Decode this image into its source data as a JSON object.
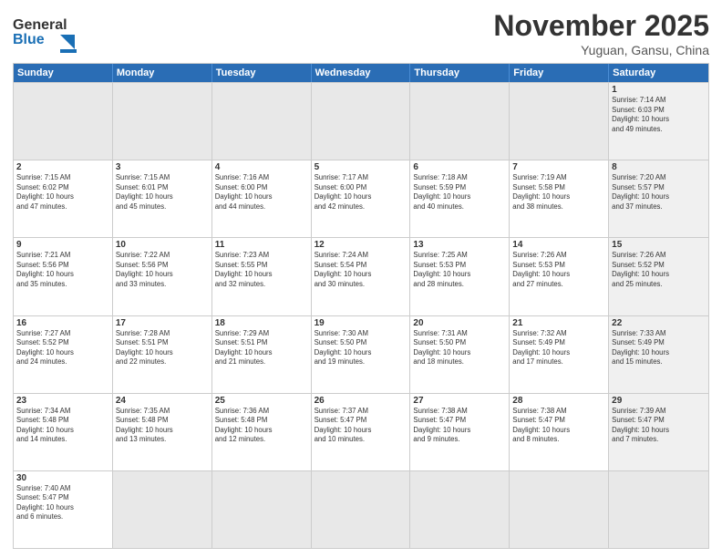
{
  "header": {
    "logo_general": "General",
    "logo_blue": "Blue",
    "month_title": "November 2025",
    "location": "Yuguan, Gansu, China"
  },
  "weekdays": [
    "Sunday",
    "Monday",
    "Tuesday",
    "Wednesday",
    "Thursday",
    "Friday",
    "Saturday"
  ],
  "rows": [
    [
      {
        "day": "",
        "info": "",
        "empty": true
      },
      {
        "day": "",
        "info": "",
        "empty": true
      },
      {
        "day": "",
        "info": "",
        "empty": true
      },
      {
        "day": "",
        "info": "",
        "empty": true
      },
      {
        "day": "",
        "info": "",
        "empty": true
      },
      {
        "day": "",
        "info": "",
        "empty": true
      },
      {
        "day": "1",
        "info": "Sunrise: 7:14 AM\nSunset: 6:03 PM\nDaylight: 10 hours\nand 49 minutes.",
        "empty": false
      }
    ],
    [
      {
        "day": "2",
        "info": "Sunrise: 7:15 AM\nSunset: 6:02 PM\nDaylight: 10 hours\nand 47 minutes.",
        "empty": false
      },
      {
        "day": "3",
        "info": "Sunrise: 7:15 AM\nSunset: 6:01 PM\nDaylight: 10 hours\nand 45 minutes.",
        "empty": false
      },
      {
        "day": "4",
        "info": "Sunrise: 7:16 AM\nSunset: 6:00 PM\nDaylight: 10 hours\nand 44 minutes.",
        "empty": false
      },
      {
        "day": "5",
        "info": "Sunrise: 7:17 AM\nSunset: 6:00 PM\nDaylight: 10 hours\nand 42 minutes.",
        "empty": false
      },
      {
        "day": "6",
        "info": "Sunrise: 7:18 AM\nSunset: 5:59 PM\nDaylight: 10 hours\nand 40 minutes.",
        "empty": false
      },
      {
        "day": "7",
        "info": "Sunrise: 7:19 AM\nSunset: 5:58 PM\nDaylight: 10 hours\nand 38 minutes.",
        "empty": false
      },
      {
        "day": "8",
        "info": "Sunrise: 7:20 AM\nSunset: 5:57 PM\nDaylight: 10 hours\nand 37 minutes.",
        "empty": false
      }
    ],
    [
      {
        "day": "9",
        "info": "Sunrise: 7:21 AM\nSunset: 5:56 PM\nDaylight: 10 hours\nand 35 minutes.",
        "empty": false
      },
      {
        "day": "10",
        "info": "Sunrise: 7:22 AM\nSunset: 5:56 PM\nDaylight: 10 hours\nand 33 minutes.",
        "empty": false
      },
      {
        "day": "11",
        "info": "Sunrise: 7:23 AM\nSunset: 5:55 PM\nDaylight: 10 hours\nand 32 minutes.",
        "empty": false
      },
      {
        "day": "12",
        "info": "Sunrise: 7:24 AM\nSunset: 5:54 PM\nDaylight: 10 hours\nand 30 minutes.",
        "empty": false
      },
      {
        "day": "13",
        "info": "Sunrise: 7:25 AM\nSunset: 5:53 PM\nDaylight: 10 hours\nand 28 minutes.",
        "empty": false
      },
      {
        "day": "14",
        "info": "Sunrise: 7:26 AM\nSunset: 5:53 PM\nDaylight: 10 hours\nand 27 minutes.",
        "empty": false
      },
      {
        "day": "15",
        "info": "Sunrise: 7:26 AM\nSunset: 5:52 PM\nDaylight: 10 hours\nand 25 minutes.",
        "empty": false
      }
    ],
    [
      {
        "day": "16",
        "info": "Sunrise: 7:27 AM\nSunset: 5:52 PM\nDaylight: 10 hours\nand 24 minutes.",
        "empty": false
      },
      {
        "day": "17",
        "info": "Sunrise: 7:28 AM\nSunset: 5:51 PM\nDaylight: 10 hours\nand 22 minutes.",
        "empty": false
      },
      {
        "day": "18",
        "info": "Sunrise: 7:29 AM\nSunset: 5:51 PM\nDaylight: 10 hours\nand 21 minutes.",
        "empty": false
      },
      {
        "day": "19",
        "info": "Sunrise: 7:30 AM\nSunset: 5:50 PM\nDaylight: 10 hours\nand 19 minutes.",
        "empty": false
      },
      {
        "day": "20",
        "info": "Sunrise: 7:31 AM\nSunset: 5:50 PM\nDaylight: 10 hours\nand 18 minutes.",
        "empty": false
      },
      {
        "day": "21",
        "info": "Sunrise: 7:32 AM\nSunset: 5:49 PM\nDaylight: 10 hours\nand 17 minutes.",
        "empty": false
      },
      {
        "day": "22",
        "info": "Sunrise: 7:33 AM\nSunset: 5:49 PM\nDaylight: 10 hours\nand 15 minutes.",
        "empty": false
      }
    ],
    [
      {
        "day": "23",
        "info": "Sunrise: 7:34 AM\nSunset: 5:48 PM\nDaylight: 10 hours\nand 14 minutes.",
        "empty": false
      },
      {
        "day": "24",
        "info": "Sunrise: 7:35 AM\nSunset: 5:48 PM\nDaylight: 10 hours\nand 13 minutes.",
        "empty": false
      },
      {
        "day": "25",
        "info": "Sunrise: 7:36 AM\nSunset: 5:48 PM\nDaylight: 10 hours\nand 12 minutes.",
        "empty": false
      },
      {
        "day": "26",
        "info": "Sunrise: 7:37 AM\nSunset: 5:47 PM\nDaylight: 10 hours\nand 10 minutes.",
        "empty": false
      },
      {
        "day": "27",
        "info": "Sunrise: 7:38 AM\nSunset: 5:47 PM\nDaylight: 10 hours\nand 9 minutes.",
        "empty": false
      },
      {
        "day": "28",
        "info": "Sunrise: 7:38 AM\nSunset: 5:47 PM\nDaylight: 10 hours\nand 8 minutes.",
        "empty": false
      },
      {
        "day": "29",
        "info": "Sunrise: 7:39 AM\nSunset: 5:47 PM\nDaylight: 10 hours\nand 7 minutes.",
        "empty": false
      }
    ],
    [
      {
        "day": "30",
        "info": "Sunrise: 7:40 AM\nSunset: 5:47 PM\nDaylight: 10 hours\nand 6 minutes.",
        "empty": false
      },
      {
        "day": "",
        "info": "",
        "empty": true
      },
      {
        "day": "",
        "info": "",
        "empty": true
      },
      {
        "day": "",
        "info": "",
        "empty": true
      },
      {
        "day": "",
        "info": "",
        "empty": true
      },
      {
        "day": "",
        "info": "",
        "empty": true
      },
      {
        "day": "",
        "info": "",
        "empty": true
      }
    ]
  ]
}
